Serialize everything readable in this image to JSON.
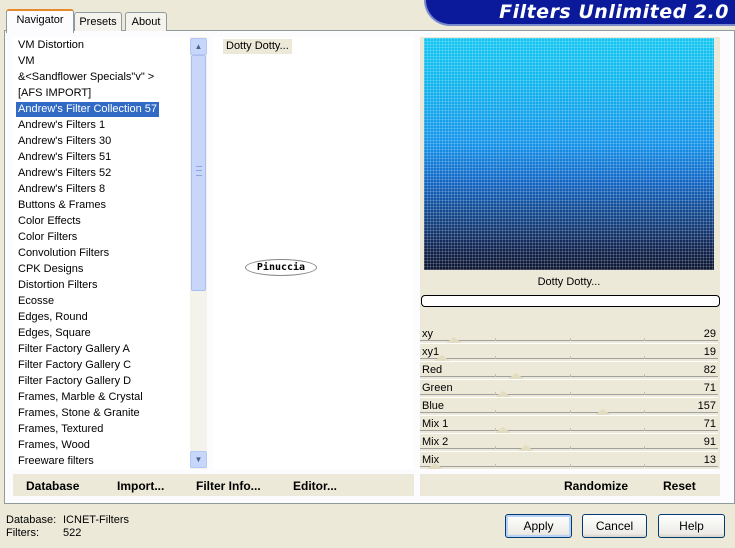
{
  "banner": {
    "title": "Filters Unlimited 2.0"
  },
  "tabs": [
    {
      "label": "Navigator",
      "active": true
    },
    {
      "label": "Presets",
      "active": false
    },
    {
      "label": "About",
      "active": false
    }
  ],
  "categories": {
    "selected_index": 4,
    "items": [
      "VM Distortion",
      "VM",
      "&<Sandflower Specials\"v\" >",
      "[AFS IMPORT]",
      "Andrew's Filter Collection 57",
      "Andrew's Filters 1",
      "Andrew's Filters 30",
      "Andrew's Filters 51",
      "Andrew's Filters 52",
      "Andrew's Filters 8",
      "Buttons & Frames",
      "Color Effects",
      "Color Filters",
      "Convolution Filters",
      "CPK Designs",
      "Distortion Filters",
      "Ecosse",
      "Edges, Round",
      "Edges, Square",
      "Filter Factory Gallery A",
      "Filter Factory Gallery C",
      "Filter Factory Gallery D",
      "Frames, Marble & Crystal",
      "Frames, Stone & Granite",
      "Frames, Textured",
      "Frames, Wood",
      "Freeware filters"
    ]
  },
  "filters": {
    "items": [
      "Dotty Dotty..."
    ],
    "selected_index": 0
  },
  "watermark": "Pinuccia",
  "preview": {
    "label": "Dotty Dotty...",
    "progress": 0
  },
  "sliders": [
    {
      "label": "xy",
      "value": "29",
      "max": 255
    },
    {
      "label": "xy1",
      "value": "19",
      "max": 255
    },
    {
      "label": "Red",
      "value": "82",
      "max": 255
    },
    {
      "label": "Green",
      "value": "71",
      "max": 255
    },
    {
      "label": "Blue",
      "value": "157",
      "max": 255
    },
    {
      "label": "Mix 1",
      "value": "71",
      "max": 255
    },
    {
      "label": "Mix 2",
      "value": "91",
      "max": 255
    },
    {
      "label": "Mix",
      "value": "13",
      "max": 255
    }
  ],
  "bottom_links": {
    "database": "Database",
    "import": "Import...",
    "filter_info": "Filter Info...",
    "editor": "Editor...",
    "randomize": "Randomize",
    "reset": "Reset"
  },
  "status": {
    "database_label": "Database:",
    "database_value": "ICNET-Filters",
    "filters_label": "Filters:",
    "filters_value": "522"
  },
  "buttons": {
    "apply": "Apply",
    "cancel": "Cancel",
    "help": "Help"
  },
  "colors": {
    "selection": "#316ac5",
    "banner": "#0a1a9a",
    "tab_accent": "#e68b2c"
  }
}
